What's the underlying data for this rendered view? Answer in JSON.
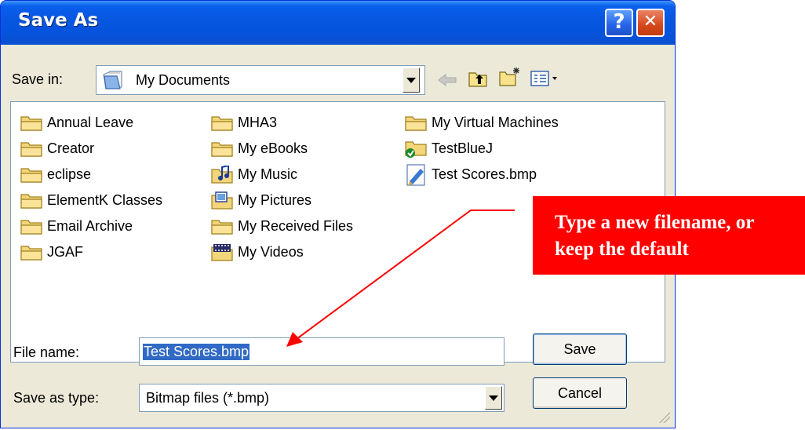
{
  "window": {
    "title": "Save As",
    "help_label": "?",
    "close_label": "✕"
  },
  "toolbar": {
    "save_in_label": "Save in:",
    "save_in_value": "My Documents",
    "icons": [
      "back-arrow-icon",
      "up-one-level-icon",
      "new-folder-icon",
      "views-menu-icon"
    ]
  },
  "files": {
    "columns": [
      [
        {
          "name": "Annual Leave",
          "icon": "folder-icon"
        },
        {
          "name": "Creator",
          "icon": "folder-icon"
        },
        {
          "name": "eclipse",
          "icon": "folder-icon"
        },
        {
          "name": "ElementK Classes",
          "icon": "folder-icon"
        },
        {
          "name": "Email Archive",
          "icon": "folder-icon"
        },
        {
          "name": "JGAF",
          "icon": "folder-icon"
        }
      ],
      [
        {
          "name": "MHA3",
          "icon": "folder-icon"
        },
        {
          "name": "My eBooks",
          "icon": "folder-icon"
        },
        {
          "name": "My Music",
          "icon": "music-folder-icon"
        },
        {
          "name": "My Pictures",
          "icon": "pictures-folder-icon"
        },
        {
          "name": "My Received Files",
          "icon": "folder-icon"
        },
        {
          "name": "My Videos",
          "icon": "videos-folder-icon"
        }
      ],
      [
        {
          "name": "My Virtual Machines",
          "icon": "folder-icon"
        },
        {
          "name": "TestBlueJ",
          "icon": "bluej-folder-icon"
        },
        {
          "name": "Test Scores.bmp",
          "icon": "bitmap-file-icon"
        }
      ]
    ]
  },
  "form": {
    "filename_label": "File name:",
    "filename_value": "Test Scores.bmp",
    "type_label": "Save as type:",
    "type_value": "Bitmap files (*.bmp)"
  },
  "buttons": {
    "save": "Save",
    "cancel": "Cancel"
  },
  "annotation": {
    "line1": "Type a new filename, or",
    "line2": "keep the default",
    "color": "#ff0000"
  },
  "colors": {
    "titlebar": "#0a5fec",
    "dialog_bg": "#ece9d8",
    "selection": "#316ac5"
  }
}
